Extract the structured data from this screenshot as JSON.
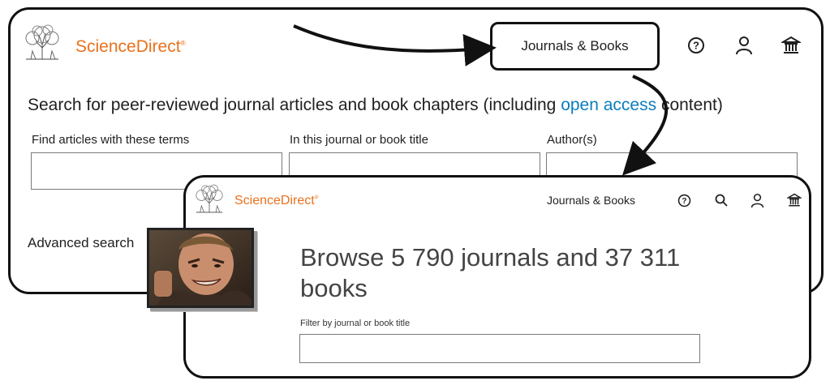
{
  "panel1": {
    "brand": "ScienceDirect",
    "nav_journals_books": "Journals & Books",
    "headline_before": "Search for peer-reviewed journal articles and book chapters (including ",
    "headline_link": "open access",
    "headline_after": " content)",
    "field_terms_label": "Find articles with these terms",
    "field_title_label": "In this journal or book title",
    "field_author_label": "Author(s)",
    "advanced_search": "Advanced search",
    "icons": [
      "help-icon",
      "user-icon",
      "institution-icon"
    ]
  },
  "panel2": {
    "brand": "ScienceDirect",
    "nav_journals_books": "Journals & Books",
    "browse_line1": "Browse 5 790 journals and 37 311",
    "browse_line2": "books",
    "filter_label": "Filter by journal or book title",
    "icons": [
      "help-icon",
      "search-icon",
      "user-icon",
      "institution-icon"
    ]
  },
  "colors": {
    "brand": "#e9711c",
    "link": "#0c7dbb",
    "outline": "#111111"
  }
}
